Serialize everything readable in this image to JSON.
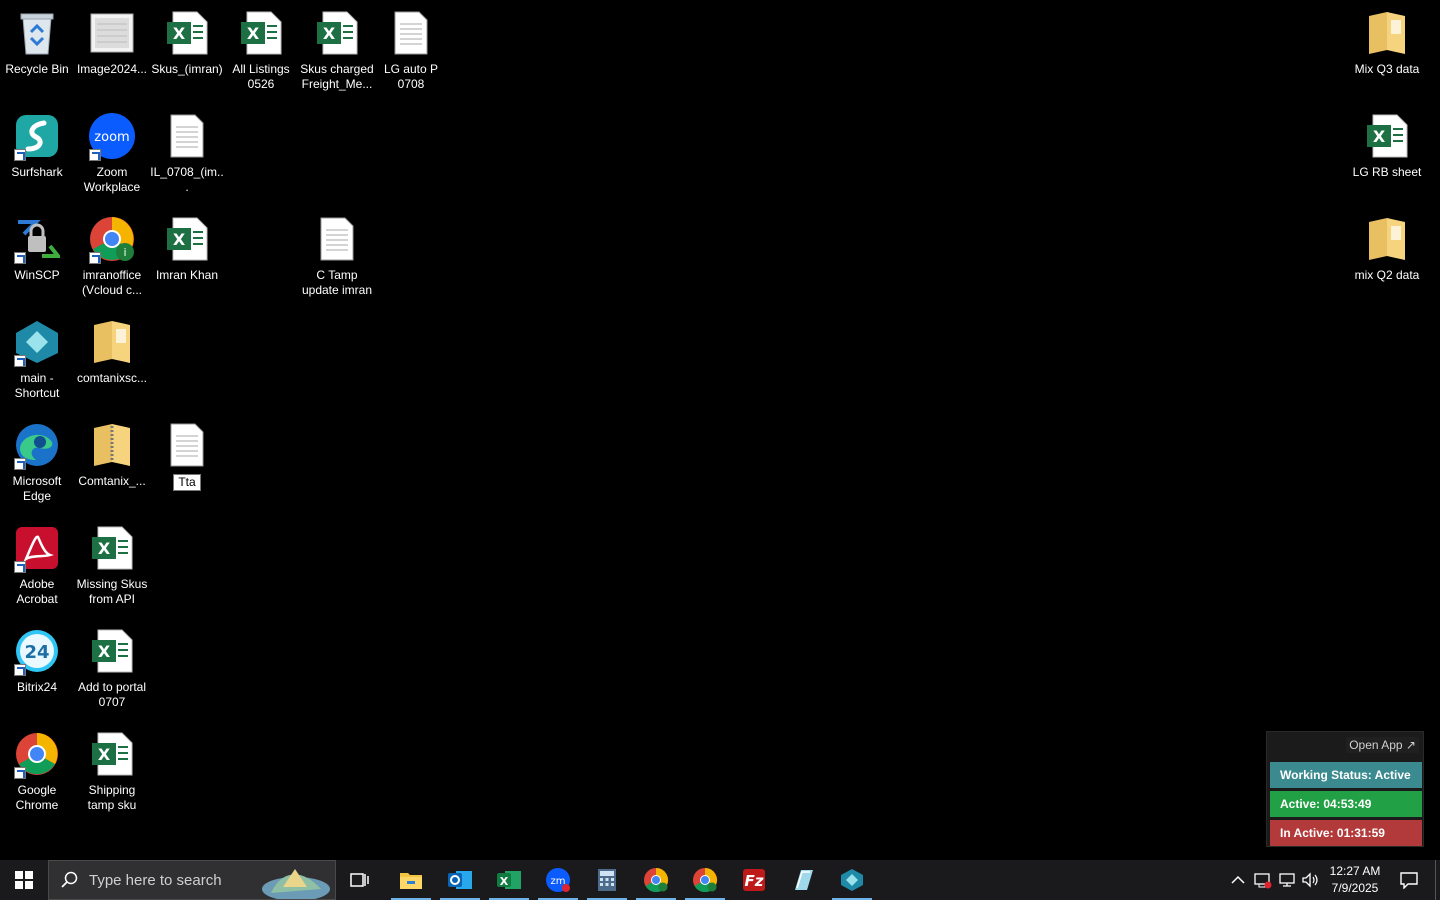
{
  "desktop": {
    "icons": [
      {
        "label": "Recycle Bin",
        "icon": "recycle-bin-icon"
      },
      {
        "label": "Image2024...",
        "icon": "image-file-icon"
      },
      {
        "label": "Skus_(imran)",
        "icon": "excel-file-icon"
      },
      {
        "label": "All Listings 0526",
        "icon": "excel-file-icon"
      },
      {
        "label": "Skus charged Freight_Me...",
        "icon": "excel-file-icon"
      },
      {
        "label": "LG auto P 0708",
        "icon": "text-file-icon"
      },
      {
        "label": "Mix Q3 data",
        "icon": "folder-icon"
      },
      {
        "label": "Surfshark",
        "icon": "surfshark-icon"
      },
      {
        "label": "Zoom Workplace",
        "icon": "zoom-icon"
      },
      {
        "label": "IL_0708_(im...",
        "icon": "text-file-icon"
      },
      {
        "label": "LG RB sheet",
        "icon": "excel-file-icon"
      },
      {
        "label": "WinSCP",
        "icon": "winscp-icon"
      },
      {
        "label": "imranoffice (Vcloud c...",
        "icon": "chrome-profile-icon"
      },
      {
        "label": "Imran Khan",
        "icon": "excel-file-icon"
      },
      {
        "label": "C Tamp update imran",
        "icon": "text-file-icon"
      },
      {
        "label": "mix Q2 data",
        "icon": "folder-icon"
      },
      {
        "label": "main - Shortcut",
        "icon": "app-shortcut-icon"
      },
      {
        "label": "comtanixsc...",
        "icon": "folder-icon"
      },
      {
        "label": "Microsoft Edge",
        "icon": "edge-icon"
      },
      {
        "label": "Comtanix_...",
        "icon": "zip-folder-icon"
      },
      {
        "label": "Tta",
        "icon": "text-file-icon"
      },
      {
        "label": "Adobe Acrobat",
        "icon": "acrobat-icon"
      },
      {
        "label": "Missing Skus from API",
        "icon": "excel-file-icon"
      },
      {
        "label": "Bitrix24",
        "icon": "bitrix24-icon"
      },
      {
        "label": "Add to portal 0707",
        "icon": "excel-file-icon"
      },
      {
        "label": "Google Chrome",
        "icon": "chrome-icon"
      },
      {
        "label": "Shipping tamp sku",
        "icon": "excel-file-icon"
      }
    ]
  },
  "widget": {
    "open_app": "Open App ↗",
    "status": "Working Status: Active",
    "active": "Active: 04:53:49",
    "inactive": "In Active: 01:31:59",
    "colors": {
      "status": "#3a8a8f",
      "active": "#22a045",
      "inactive": "#b23a3a"
    }
  },
  "taskbar": {
    "search_placeholder": "Type here to search",
    "apps": [
      "task-view",
      "file-explorer",
      "outlook",
      "excel",
      "zoom",
      "calculator",
      "chrome",
      "chrome-profile",
      "filezilla",
      "notepad-app",
      "main-app"
    ],
    "time": "12:27 AM",
    "date": "7/9/2025"
  }
}
